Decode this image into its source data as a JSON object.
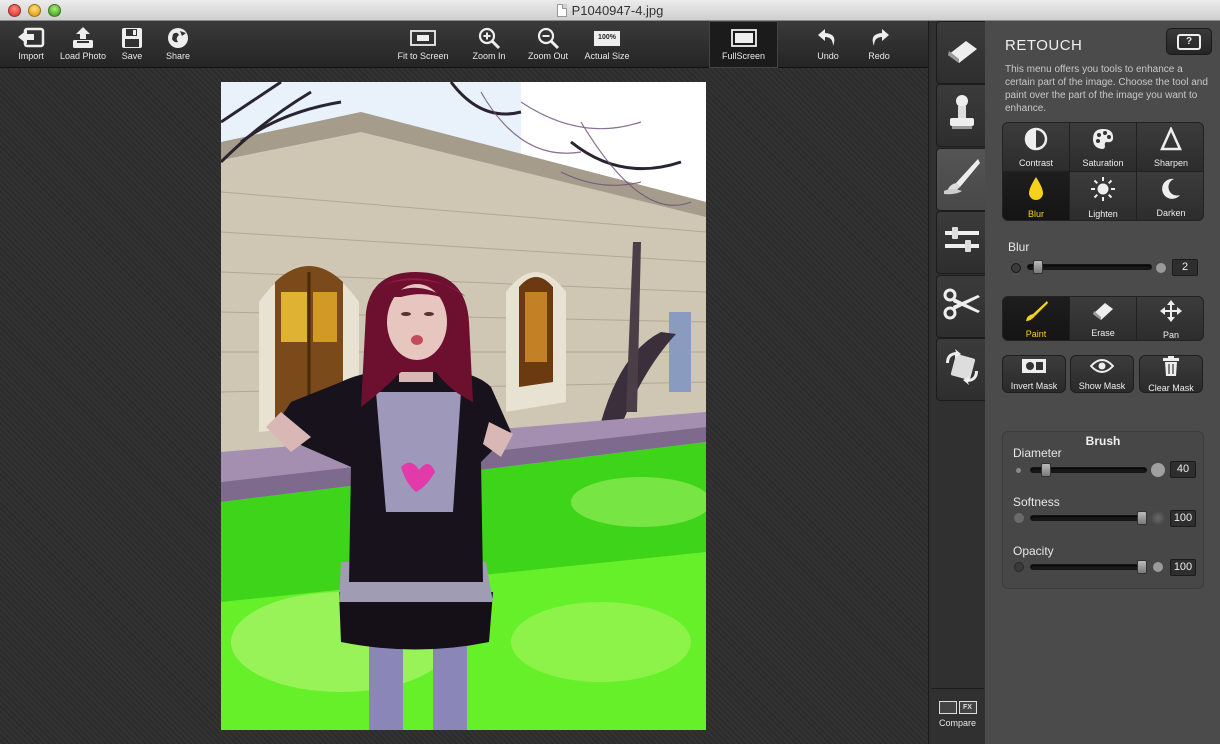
{
  "window": {
    "title": "P1040947-4.jpg"
  },
  "toolbar": {
    "import": "Import",
    "load_photo": "Load Photo",
    "save": "Save",
    "share": "Share",
    "fit_to_screen": "Fit to Screen",
    "zoom_in": "Zoom In",
    "zoom_out": "Zoom Out",
    "actual_size": "Actual Size",
    "actual_size_icon_text": "100%",
    "fullscreen": "FullScreen",
    "undo": "Undo",
    "redo": "Redo"
  },
  "tool_column": {
    "tabs": [
      "eraser-tool",
      "stamp-tool",
      "retouch-brush-tool",
      "adjust-sliders-tool",
      "crop-scissors-tool",
      "rotate-tool"
    ],
    "active_tab": "retouch-brush-tool",
    "compare_label": "Compare",
    "compare_fx": "FX"
  },
  "panel": {
    "title": "RETOUCH",
    "help_icon_text": "?",
    "description": "This menu offers you tools to enhance a certain part of the image. Choose the tool and paint over the part of the image you want to enhance.",
    "tools": [
      {
        "label": "Contrast",
        "icon": "contrast-icon"
      },
      {
        "label": "Saturation",
        "icon": "palette-icon"
      },
      {
        "label": "Sharpen",
        "icon": "triangle-icon"
      },
      {
        "label": "Blur",
        "icon": "drop-icon",
        "active": true
      },
      {
        "label": "Lighten",
        "icon": "sun-icon"
      },
      {
        "label": "Darken",
        "icon": "moon-icon"
      }
    ],
    "blur": {
      "label": "Blur",
      "value": "2",
      "level": 0.05
    },
    "modes": [
      {
        "label": "Paint",
        "icon": "brush-icon",
        "active": true
      },
      {
        "label": "Erase",
        "icon": "eraser-icon"
      },
      {
        "label": "Pan",
        "icon": "move-icon"
      }
    ],
    "mask_buttons": {
      "invert": "Invert Mask",
      "show": "Show Mask",
      "clear": "Clear Mask"
    },
    "brush": {
      "title": "Brush",
      "diameter": {
        "label": "Diameter",
        "value": "40",
        "level": 0.1
      },
      "softness": {
        "label": "Softness",
        "value": "100",
        "level": 1.0
      },
      "opacity": {
        "label": "Opacity",
        "value": "100",
        "level": 1.0
      }
    }
  },
  "colors": {
    "accent_active": "#f7d21a",
    "panel_bg": "#4b4b4b",
    "toolbar_bg": "#2a2a2a"
  }
}
